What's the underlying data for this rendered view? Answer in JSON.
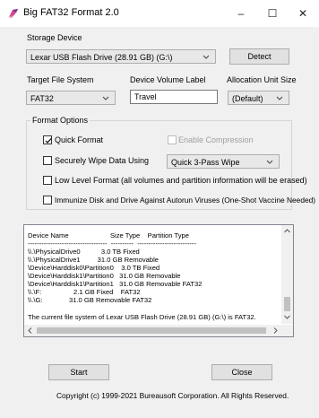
{
  "window": {
    "title": "Big FAT32 Format 2.0",
    "minimize": "–",
    "maximize": "☐",
    "close": "✕"
  },
  "storage": {
    "label": "Storage Device",
    "device": "Lexar USB Flash Drive (28.91 GB) (G:\\)",
    "detect_label": "Detect"
  },
  "target_fs": {
    "label": "Target File System",
    "value": "FAT32"
  },
  "volume_label": {
    "label": "Device Volume Label",
    "value": "Travel"
  },
  "allocation": {
    "label": "Allocation Unit Size",
    "value": "(Default)"
  },
  "options": {
    "title": "Format Options",
    "quick_format": {
      "label": "Quick Format",
      "checked": true
    },
    "enable_compression": {
      "label": "Enable Compression",
      "checked": false
    },
    "secure_wipe": {
      "label": "Securely Wipe Data Using",
      "checked": false
    },
    "wipe_method": "Quick 3-Pass Wipe",
    "low_level": {
      "label": "Low Level Format (all volumes and partition information will be erased)",
      "checked": false
    },
    "immunize": {
      "label": "Immunize Disk and Drive Against Autorun Viruses (One-Shot Vaccine Needed)",
      "checked": false
    }
  },
  "log": {
    "lines": [
      "Device Name                      Size Type    Partition Type",
      "-----------------------------------  ----------  --------------------------",
      "\\\\.\\PhysicalDrive0           3.0 TB Fixed",
      "\\\\.\\PhysicalDrive1         31.0 GB Removable",
      "\\Device\\Harddisk0\\Partition0    3.0 TB Fixed",
      "\\Device\\Harddisk1\\Partition0   31.0 GB Removable",
      "\\Device\\Harddisk1\\Partition1   31.0 GB Removable FAT32",
      "\\\\.\\F:                 2.1 GB Fixed    FAT32",
      "\\\\.\\G:              31.0 GB Removable FAT32",
      "",
      "The current file system of Lexar USB Flash Drive (28.91 GB) (G:\\) is FAT32."
    ]
  },
  "footer": {
    "start_label": "Start",
    "close_label": "Close",
    "copyright": "Copyright (c) 1999-2021 Bureausoft Corporation. All Rights Reserved."
  }
}
